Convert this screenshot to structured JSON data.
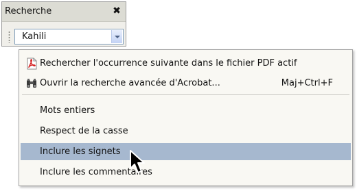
{
  "panel": {
    "title": "Recherche",
    "close_glyph": "✖",
    "search_value": "Kahili"
  },
  "menu": {
    "items": [
      {
        "label": "Rechercher l'occurrence suivante dans le fichier PDF actif",
        "shortcut": "",
        "icon": "pdf-file-icon"
      },
      {
        "label": "Ouvrir la recherche avancée d'Acrobat...",
        "shortcut": "Maj+Ctrl+F",
        "icon": "binoculars-icon"
      },
      {
        "label": "Mots entiers",
        "shortcut": ""
      },
      {
        "label": "Respect de la casse",
        "shortcut": ""
      },
      {
        "label": "Inclure les signets",
        "shortcut": "",
        "highlighted": true
      },
      {
        "label": "Inclure les commentaires",
        "shortcut": ""
      }
    ]
  },
  "colors": {
    "highlight": "#a6b8cf",
    "menu_background": "#f9f8f3",
    "pdf_icon_red": "#d42020"
  }
}
